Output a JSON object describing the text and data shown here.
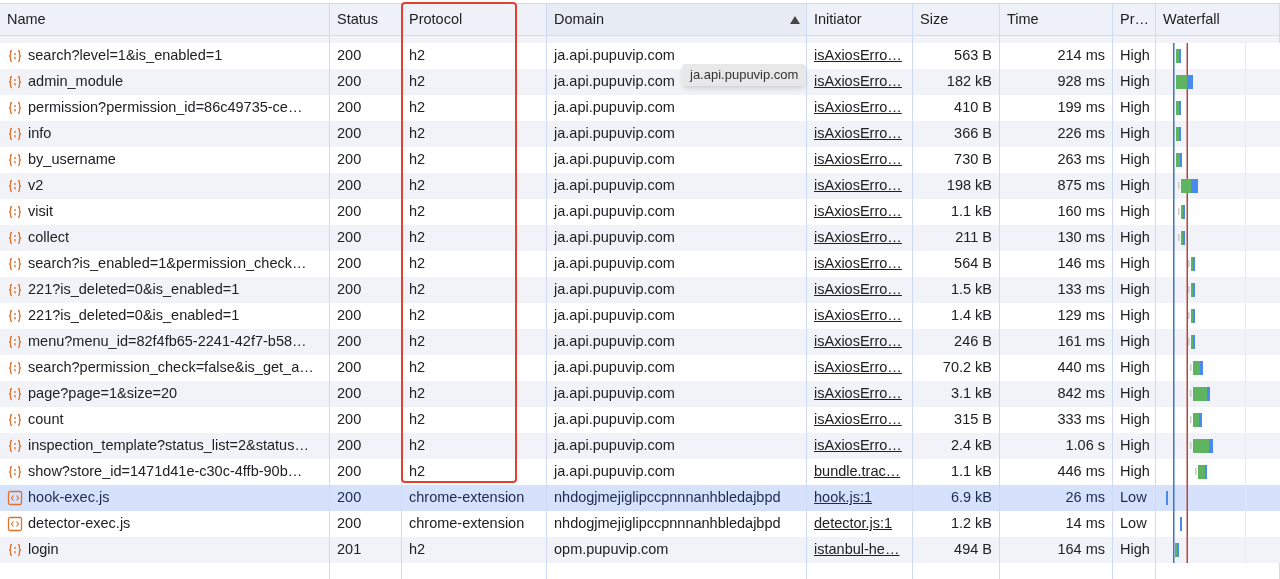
{
  "columns": [
    {
      "label": "Name",
      "sorted": false
    },
    {
      "label": "Status",
      "sorted": false
    },
    {
      "label": "Protocol",
      "sorted": false
    },
    {
      "label": "Domain",
      "sorted": true
    },
    {
      "label": "Initiator",
      "sorted": false
    },
    {
      "label": "Size",
      "sorted": false
    },
    {
      "label": "Time",
      "sorted": false
    },
    {
      "label": "Pr…",
      "sorted": false
    },
    {
      "label": "Waterfall",
      "sorted": false
    }
  ],
  "rows": [
    {
      "kind": "fetch",
      "name": "search?level=1&is_enabled=1",
      "status": "200",
      "protocol": "h2",
      "domain": "ja.api.pupuvip.com",
      "initiator": "isAxiosErro…",
      "size": "563 B",
      "time": "214 ms",
      "priority": "High",
      "selected": false
    },
    {
      "kind": "fetch",
      "name": "admin_module",
      "status": "200",
      "protocol": "h2",
      "domain": "ja.api.pupuvip.com",
      "initiator": "isAxiosErro…",
      "size": "182 kB",
      "time": "928 ms",
      "priority": "High",
      "selected": false
    },
    {
      "kind": "fetch",
      "name": "permission?permission_id=86c49735-ce…",
      "status": "200",
      "protocol": "h2",
      "domain": "ja.api.pupuvip.com",
      "initiator": "isAxiosErro…",
      "size": "410 B",
      "time": "199 ms",
      "priority": "High",
      "selected": false
    },
    {
      "kind": "fetch",
      "name": "info",
      "status": "200",
      "protocol": "h2",
      "domain": "ja.api.pupuvip.com",
      "initiator": "isAxiosErro…",
      "size": "366 B",
      "time": "226 ms",
      "priority": "High",
      "selected": false
    },
    {
      "kind": "fetch",
      "name": "by_username",
      "status": "200",
      "protocol": "h2",
      "domain": "ja.api.pupuvip.com",
      "initiator": "isAxiosErro…",
      "size": "730 B",
      "time": "263 ms",
      "priority": "High",
      "selected": false
    },
    {
      "kind": "fetch",
      "name": "v2",
      "status": "200",
      "protocol": "h2",
      "domain": "ja.api.pupuvip.com",
      "initiator": "isAxiosErro…",
      "size": "198 kB",
      "time": "875 ms",
      "priority": "High",
      "selected": false
    },
    {
      "kind": "fetch",
      "name": "visit",
      "status": "200",
      "protocol": "h2",
      "domain": "ja.api.pupuvip.com",
      "initiator": "isAxiosErro…",
      "size": "1.1 kB",
      "time": "160 ms",
      "priority": "High",
      "selected": false
    },
    {
      "kind": "fetch",
      "name": "collect",
      "status": "200",
      "protocol": "h2",
      "domain": "ja.api.pupuvip.com",
      "initiator": "isAxiosErro…",
      "size": "211 B",
      "time": "130 ms",
      "priority": "High",
      "selected": false
    },
    {
      "kind": "fetch",
      "name": "search?is_enabled=1&permission_check…",
      "status": "200",
      "protocol": "h2",
      "domain": "ja.api.pupuvip.com",
      "initiator": "isAxiosErro…",
      "size": "564 B",
      "time": "146 ms",
      "priority": "High",
      "selected": false
    },
    {
      "kind": "fetch",
      "name": "221?is_deleted=0&is_enabled=1",
      "status": "200",
      "protocol": "h2",
      "domain": "ja.api.pupuvip.com",
      "initiator": "isAxiosErro…",
      "size": "1.5 kB",
      "time": "133 ms",
      "priority": "High",
      "selected": false
    },
    {
      "kind": "fetch",
      "name": "221?is_deleted=0&is_enabled=1",
      "status": "200",
      "protocol": "h2",
      "domain": "ja.api.pupuvip.com",
      "initiator": "isAxiosErro…",
      "size": "1.4 kB",
      "time": "129 ms",
      "priority": "High",
      "selected": false
    },
    {
      "kind": "fetch",
      "name": "menu?menu_id=82f4fb65-2241-42f7-b58…",
      "status": "200",
      "protocol": "h2",
      "domain": "ja.api.pupuvip.com",
      "initiator": "isAxiosErro…",
      "size": "246 B",
      "time": "161 ms",
      "priority": "High",
      "selected": false
    },
    {
      "kind": "fetch",
      "name": "search?permission_check=false&is_get_a…",
      "status": "200",
      "protocol": "h2",
      "domain": "ja.api.pupuvip.com",
      "initiator": "isAxiosErro…",
      "size": "70.2 kB",
      "time": "440 ms",
      "priority": "High",
      "selected": false
    },
    {
      "kind": "fetch",
      "name": "page?page=1&size=20",
      "status": "200",
      "protocol": "h2",
      "domain": "ja.api.pupuvip.com",
      "initiator": "isAxiosErro…",
      "size": "3.1 kB",
      "time": "842 ms",
      "priority": "High",
      "selected": false
    },
    {
      "kind": "fetch",
      "name": "count",
      "status": "200",
      "protocol": "h2",
      "domain": "ja.api.pupuvip.com",
      "initiator": "isAxiosErro…",
      "size": "315 B",
      "time": "333 ms",
      "priority": "High",
      "selected": false
    },
    {
      "kind": "fetch",
      "name": "inspection_template?status_list=2&status…",
      "status": "200",
      "protocol": "h2",
      "domain": "ja.api.pupuvip.com",
      "initiator": "isAxiosErro…",
      "size": "2.4 kB",
      "time": "1.06 s",
      "priority": "High",
      "selected": false
    },
    {
      "kind": "fetch",
      "name": "show?store_id=1471d41e-c30c-4ffb-90b…",
      "status": "200",
      "protocol": "h2",
      "domain": "ja.api.pupuvip.com",
      "initiator": "bundle.trac…",
      "size": "1.1 kB",
      "time": "446 ms",
      "priority": "High",
      "selected": false
    },
    {
      "kind": "script",
      "name": "hook-exec.js",
      "status": "200",
      "protocol": "chrome-extension",
      "domain": "nhdogjmejiglipccpnnnanhbledajbpd",
      "initiator": "hook.js:1",
      "size": "6.9 kB",
      "time": "26 ms",
      "priority": "Low",
      "selected": true
    },
    {
      "kind": "script",
      "name": "detector-exec.js",
      "status": "200",
      "protocol": "chrome-extension",
      "domain": "nhdogjmejiglipccpnnnanhbledajbpd",
      "initiator": "detector.js:1",
      "size": "1.2 kB",
      "time": "14 ms",
      "priority": "Low",
      "selected": false
    },
    {
      "kind": "fetch",
      "name": "login",
      "status": "201",
      "protocol": "h2",
      "domain": "opm.pupuvip.com",
      "initiator": "istanbul-he…",
      "size": "494 B",
      "time": "164 ms",
      "priority": "High",
      "selected": false
    }
  ],
  "tooltip": "ja.api.pupuvip.com"
}
